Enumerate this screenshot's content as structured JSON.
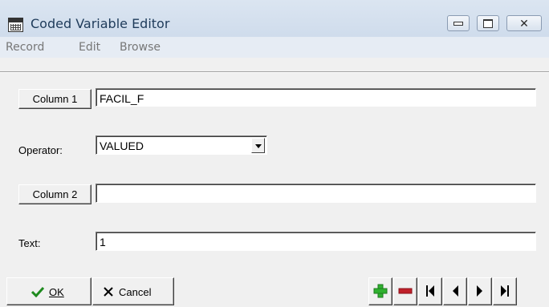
{
  "window": {
    "title": "Coded Variable Editor",
    "icons": {
      "app": "spreadsheet-app-icon",
      "minimize": "minimize-icon",
      "maximize": "maximize-icon",
      "close": "close-icon"
    }
  },
  "menu": {
    "items": [
      "Record",
      "Edit",
      "Browse"
    ]
  },
  "form": {
    "column1_button": "Column 1",
    "column1_value": "FACIL_F",
    "operator_label": "Operator:",
    "operator_value": "VALUED",
    "column2_button": "Column 2",
    "column2_value": "",
    "text_label": "Text:",
    "text_value": "1"
  },
  "footer": {
    "ok_label": "OK",
    "ok_icon": "checkmark-icon",
    "cancel_label": "Cancel",
    "cancel_icon": "x-icon",
    "nav_icons": [
      "add-record-icon",
      "delete-record-icon",
      "first-record-icon",
      "previous-record-icon",
      "next-record-icon",
      "last-record-icon"
    ]
  },
  "colors": {
    "titlebar": "#d6e1ee",
    "menubar": "#e6ecf4",
    "face": "#f0f0f0",
    "add": "#2fb12f",
    "delete": "#c0202a"
  }
}
